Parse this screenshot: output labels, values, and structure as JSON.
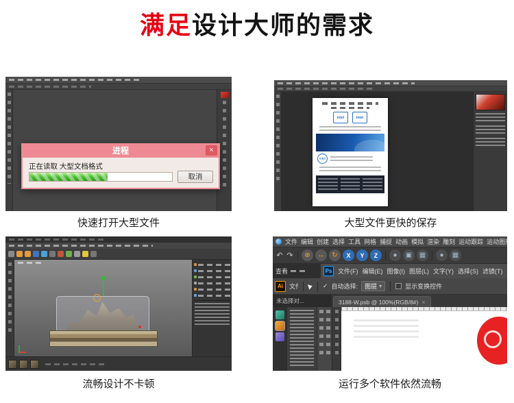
{
  "title": {
    "highlight": "满足",
    "rest": "设计大师的需求"
  },
  "captions": {
    "open": "快速打开大型文件",
    "save": "大型文件更快的保存",
    "c4d": "流畅设计不卡顿",
    "multi": "运行多个软件依然流畅"
  },
  "dialog": {
    "title": "进程",
    "message": "正在读取 大型文档格式",
    "cancel": "取消",
    "progress_percent": 55
  },
  "save_doc": {
    "brand": "intel"
  },
  "multi": {
    "menus": [
      "文件",
      "编辑",
      "创建",
      "选择",
      "工具",
      "网格",
      "捕捉",
      "动画",
      "模拟",
      "渲染",
      "雕刻",
      "运动跟踪",
      "运动图形"
    ],
    "axis": [
      "X",
      "Y",
      "Z"
    ],
    "view_tab": "查看",
    "ps_logo": "Ps",
    "ps_menus": [
      "文件(F)",
      "编辑(E)",
      "图像(I)",
      "图层(L)",
      "文字(Y)",
      "选择(S)",
      "滤镜(T)"
    ],
    "ai_logo": "Ai",
    "ai_menu_first": "文件",
    "auto_select_label": "自动选择:",
    "auto_select_value": "图层",
    "show_transform_label": "显示变换控件",
    "status": "未选择对...",
    "doc_tab": "3188-W.psb @ 100%(RGB/8#)"
  },
  "icons": {
    "close": "×",
    "check": "✓",
    "dropdown": "▾",
    "undo": "↶",
    "redo": "↷",
    "move": "⊕",
    "scale": "↔",
    "rotate": "↻",
    "camera": "▣",
    "grid": "▦",
    "dot": "●"
  },
  "colors": {
    "accent_red": "#e60012",
    "dialog_pink": "#ed8a93",
    "progress_green": "#49b52e",
    "ps_blue": "#31a8ff",
    "ai_orange": "#ff9a00",
    "axis_blue": "#2e6db4"
  }
}
